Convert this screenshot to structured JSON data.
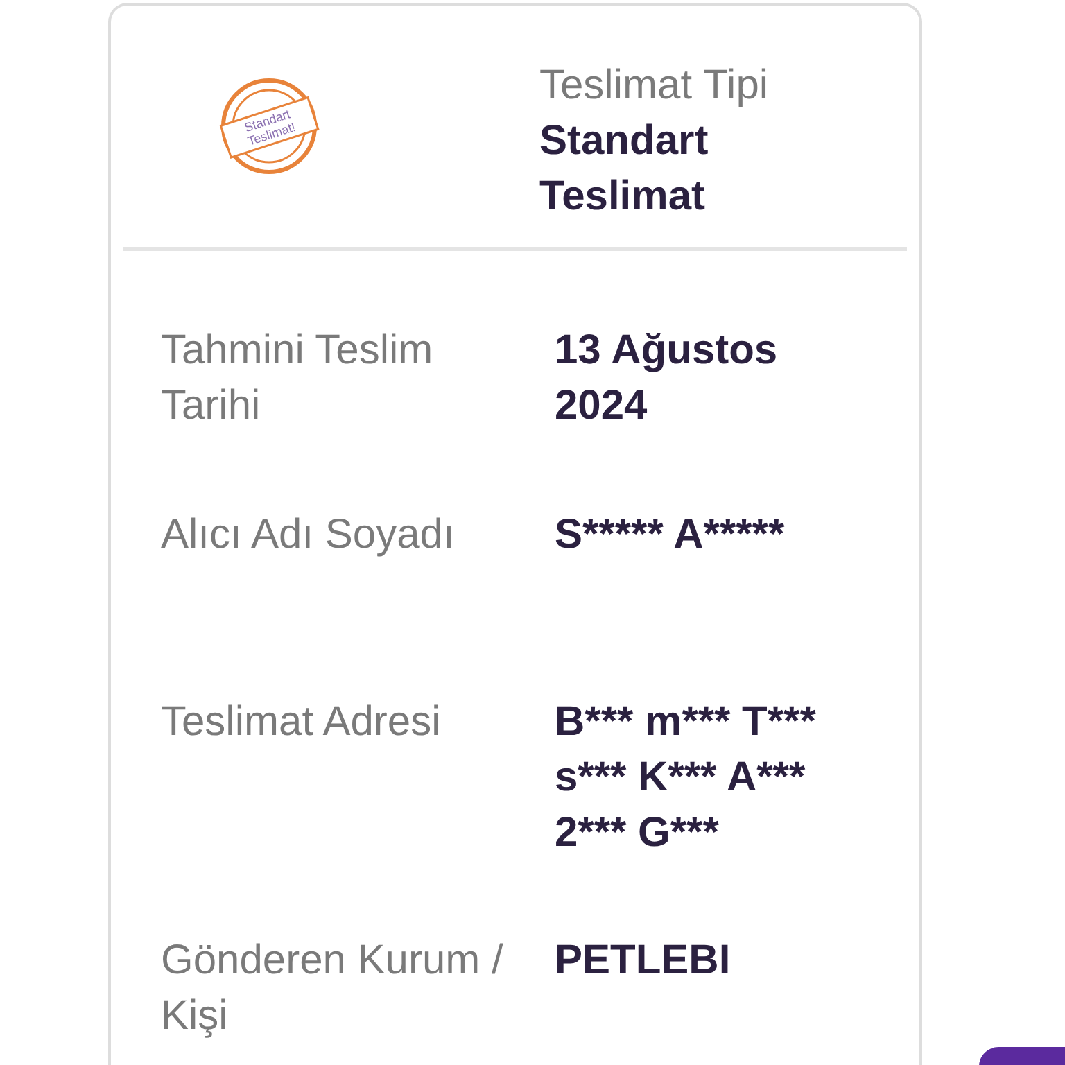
{
  "header": {
    "stamp_text": [
      "Standart",
      "Teslimat!"
    ],
    "label": "Teslimat Tipi",
    "value": "Standart Teslimat"
  },
  "rows": [
    {
      "label": "Tahmini Teslim Tarihi",
      "value": "13 Ağustos 2024"
    },
    {
      "label": "Alıcı Adı Soyadı",
      "value": "S***** A*****"
    },
    {
      "label": "Teslimat Adresi",
      "value": "B*** m*** T*** s*** K*** A*** 2*** G***"
    },
    {
      "label": "Gönderen Kurum / Kişi",
      "value": "PETLEBI"
    }
  ]
}
